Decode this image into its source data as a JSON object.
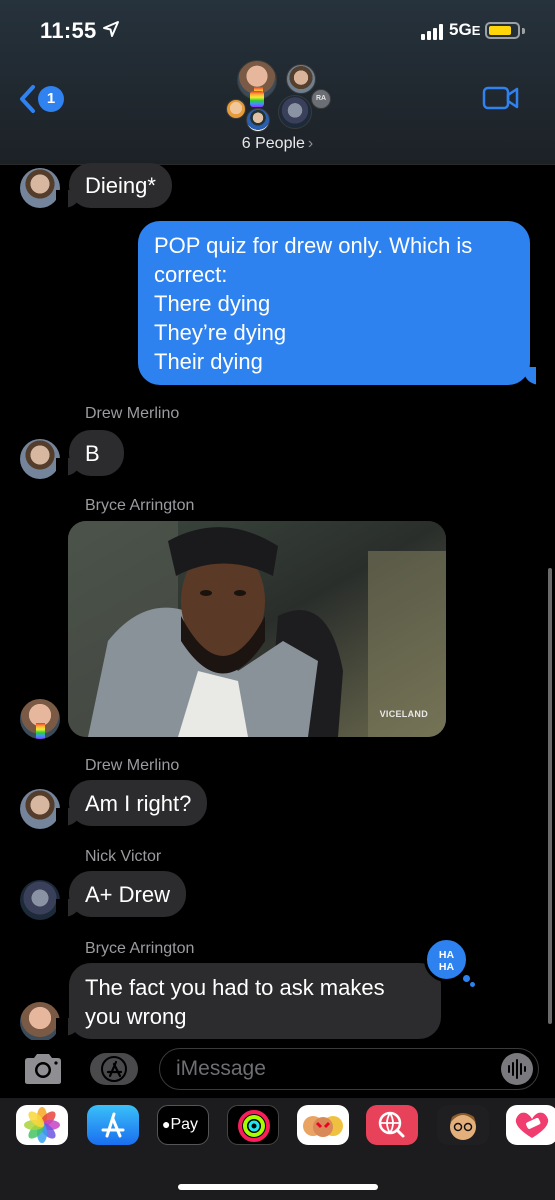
{
  "status_bar": {
    "time": "11:55",
    "network": "5G",
    "network_suffix": "E",
    "battery_level": 0.8
  },
  "header": {
    "back_badge_count": "1",
    "group_label": "6 People",
    "group_chevron": "›",
    "avatar_initials": "RA",
    "icons": [
      "back-chevron-icon",
      "video-camera-icon",
      "location-arrow-icon"
    ]
  },
  "messages": [
    {
      "type": "incoming",
      "text": "Dieing*"
    },
    {
      "type": "outgoing",
      "lines": [
        "POP quiz for drew only. Which is",
        "correct:",
        "There dying",
        "They’re dying",
        "Their dying"
      ]
    },
    {
      "type": "incoming",
      "sender": "Drew Merlino",
      "text": "B"
    },
    {
      "type": "incoming-media",
      "sender": "Bryce Arrington",
      "watermark": "VICELAND"
    },
    {
      "type": "incoming",
      "sender": "Drew Merlino",
      "text": "Am I right?"
    },
    {
      "type": "incoming",
      "sender": "Nick Victor",
      "text": "A+ Drew"
    },
    {
      "type": "incoming",
      "sender": "Bryce Arrington",
      "lines": [
        "The fact you had to ask makes",
        "you wrong"
      ],
      "tapback": [
        "HA",
        "HA"
      ]
    }
  ],
  "input_bar": {
    "placeholder": "iMessage",
    "icons": [
      "camera-icon",
      "app-store-icon",
      "audio-waveform-icon"
    ]
  },
  "app_drawer": {
    "apps": [
      {
        "name": "photos-app-icon",
        "label": ""
      },
      {
        "name": "app-store-icon",
        "label": ""
      },
      {
        "name": "apple-pay-icon",
        "label": "Pay"
      },
      {
        "name": "activity-icon",
        "label": ""
      },
      {
        "name": "memoji-stickers-icon",
        "label": ""
      },
      {
        "name": "web-search-icon",
        "label": ""
      },
      {
        "name": "memoji-icon",
        "label": ""
      },
      {
        "name": "heart-app-icon",
        "label": ""
      }
    ]
  },
  "colors": {
    "outgoing_bubble": "#2e82f0",
    "incoming_bubble": "#2c2c2e",
    "accent": "#2f82f0",
    "background": "#000000"
  }
}
